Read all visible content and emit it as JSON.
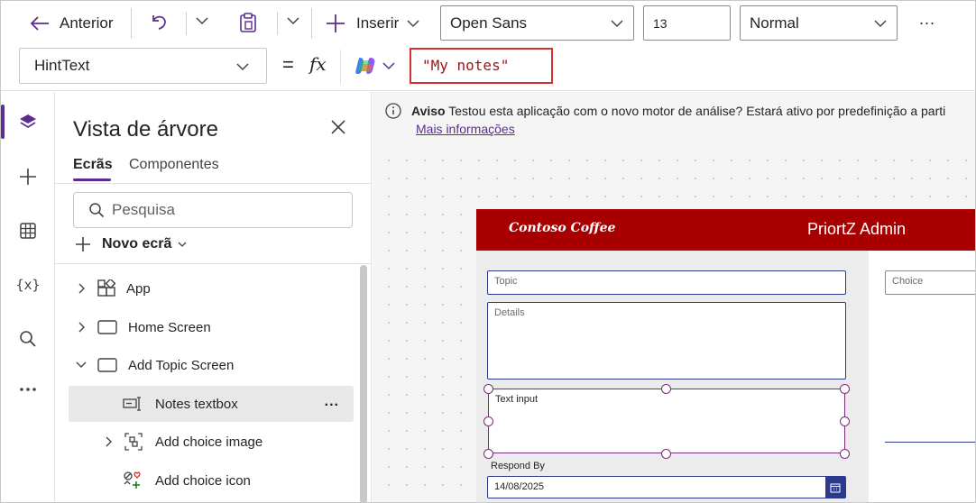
{
  "toolbar": {
    "back_label": "Anterior",
    "insert_label": "Inserir",
    "font_family_value": "Open Sans",
    "font_size_value": "13",
    "font_weight_value": "Normal",
    "more_label": "..."
  },
  "formula_bar": {
    "property": "HintText",
    "equals": "=",
    "fx": "fx",
    "formula": "\"My notes\""
  },
  "tree_view": {
    "title": "Vista de árvore",
    "tabs": [
      "Ecrãs",
      "Componentes"
    ],
    "search_placeholder": "Pesquisa",
    "new_screen_label": "Novo ecrã",
    "items": [
      {
        "label": "App"
      },
      {
        "label": "Home Screen"
      },
      {
        "label": "Add Topic Screen"
      },
      {
        "label": "Notes textbox",
        "more": "..."
      },
      {
        "label": "Add choice image"
      },
      {
        "label": "Add choice icon"
      }
    ]
  },
  "notice": {
    "title": "Aviso",
    "text": "Testou esta aplicação com o novo motor de análise? Estará ativo por predefinição a parti",
    "link": "Mais informações"
  },
  "app_preview": {
    "logo_text": "Contoso Coffee",
    "header_title": "PriortZ Admin",
    "topic_placeholder": "Topic",
    "details_placeholder": "Details",
    "notes_text": "Text input",
    "respond_by_label": "Respond By",
    "date_value": "14/08/2025",
    "choice_placeholder": "Choice",
    "colors": {
      "header": "#a80000",
      "selection": "#7a2d7a",
      "input_border": "#2b3a8c"
    }
  }
}
